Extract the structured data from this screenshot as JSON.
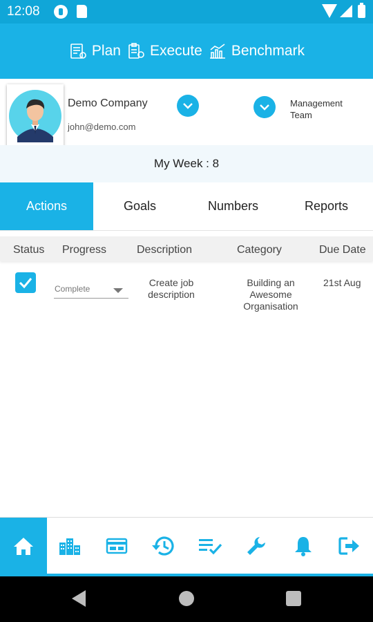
{
  "status_bar": {
    "time": "12:08"
  },
  "banner": {
    "plan": "Plan",
    "execute": "Execute",
    "benchmark": "Benchmark"
  },
  "profile": {
    "company": "Demo Company",
    "email": "john@demo.com",
    "team_line1": "Management",
    "team_line2": "Team"
  },
  "week": {
    "label": "My Week : 8"
  },
  "tabs": [
    {
      "label": "Actions",
      "active": true
    },
    {
      "label": "Goals",
      "active": false
    },
    {
      "label": "Numbers",
      "active": false
    },
    {
      "label": "Reports",
      "active": false
    }
  ],
  "table": {
    "headers": [
      "Status",
      "Progress",
      "Description",
      "Category",
      "Due Date"
    ],
    "rows": [
      {
        "status_checked": true,
        "progress": "Complete",
        "description": "Create job description",
        "category": "Building an Awesome Organisation",
        "due_date": "21st  Aug"
      }
    ]
  },
  "bottom_nav": [
    "home-icon",
    "buildings-icon",
    "card-icon",
    "history-icon",
    "checklist-icon",
    "wrench-icon",
    "bell-icon",
    "logout-icon"
  ],
  "colors": {
    "accent": "#1ab2e6",
    "status_bar": "#10a6d8"
  }
}
